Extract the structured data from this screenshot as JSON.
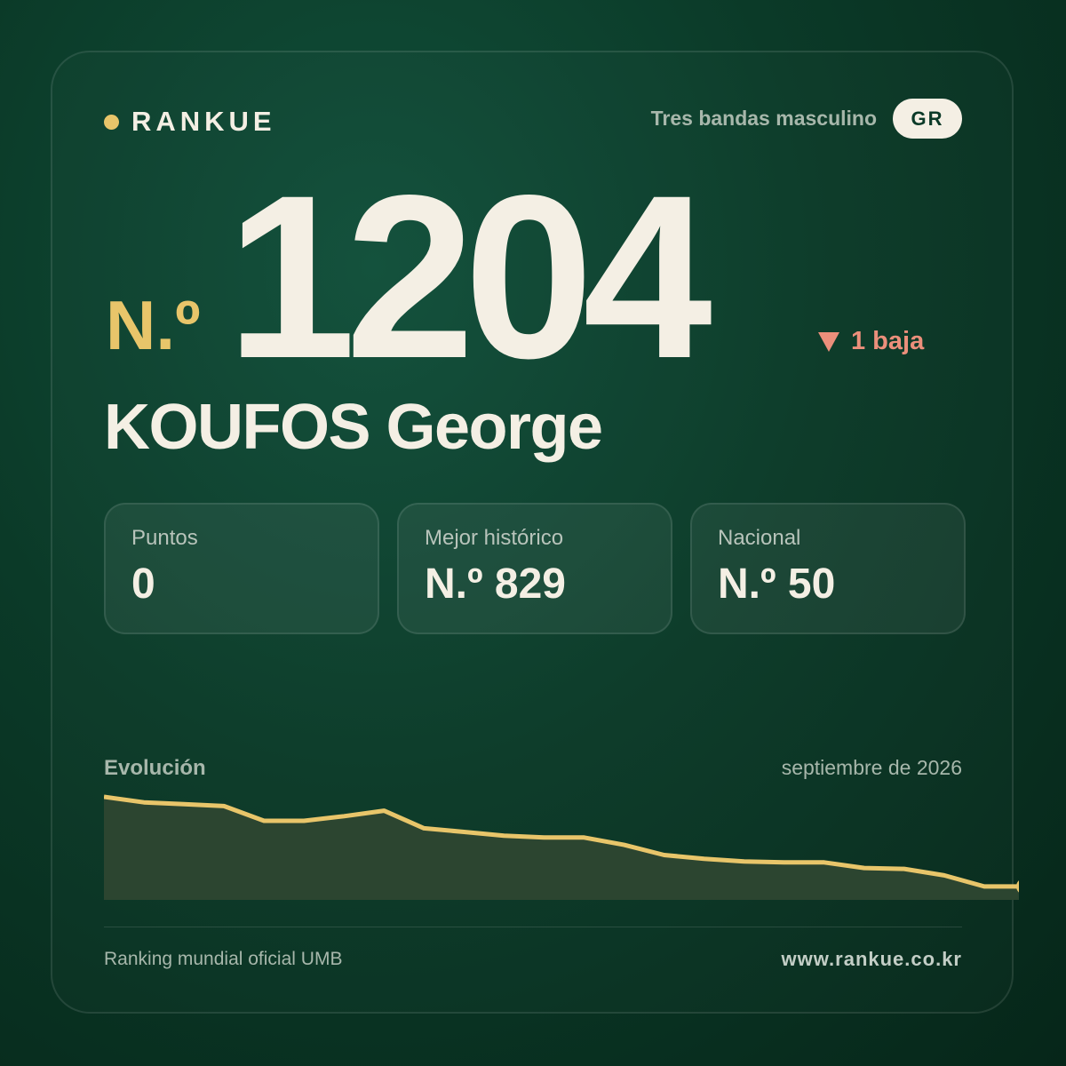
{
  "brand": {
    "name": "RANKUE"
  },
  "header": {
    "category": "Tres bandas masculino",
    "country": "GR"
  },
  "rank": {
    "prefix": "N.º",
    "number": "1204",
    "change": "1 baja",
    "direction": "down"
  },
  "player": {
    "name": "KOUFOS George"
  },
  "stats": [
    {
      "label": "Puntos",
      "value": "0"
    },
    {
      "label": "Mejor histórico",
      "value": "N.º 829"
    },
    {
      "label": "Nacional",
      "value": "N.º 50"
    }
  ],
  "evolution": {
    "title": "Evolución",
    "date": "septiembre de 2026"
  },
  "chart_data": {
    "type": "area",
    "title": "Evolución",
    "xlabel": "",
    "ylabel": "",
    "inverted": true,
    "grid": false,
    "series": [
      {
        "values": [
          0.0,
          0.06,
          0.08,
          0.1,
          0.26,
          0.26,
          0.21,
          0.15,
          0.34,
          0.38,
          0.42,
          0.44,
          0.44,
          0.52,
          0.63,
          0.67,
          0.7,
          0.71,
          0.71,
          0.77,
          0.78,
          0.85,
          0.97,
          0.97
        ]
      }
    ]
  },
  "footer": {
    "left": "Ranking mundial oficial UMB",
    "right": "www.rankue.co.kr"
  },
  "colors": {
    "accent_gold": "#e8c56a",
    "down_red": "#eb8f7b",
    "cream": "#f4efe4",
    "chart_fill": "#2c4530",
    "bg": "#0b3a28"
  }
}
